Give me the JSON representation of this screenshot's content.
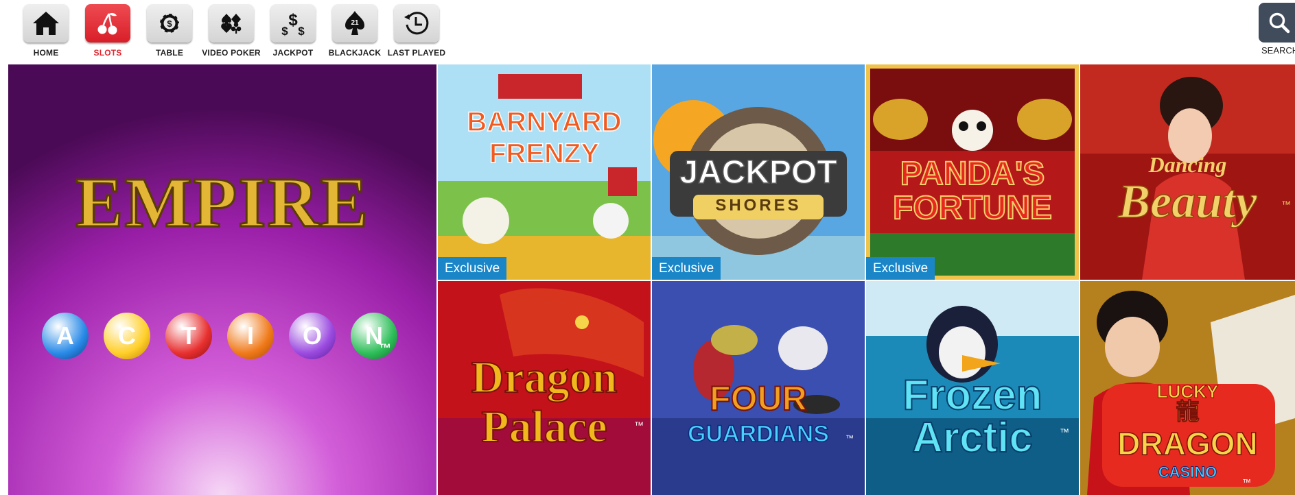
{
  "nav": {
    "items": [
      {
        "label": "HOME",
        "icon": "home-icon",
        "active": false
      },
      {
        "label": "SLOTS",
        "icon": "cherries-icon",
        "active": true
      },
      {
        "label": "TABLE",
        "icon": "casino-chip-icon",
        "active": false
      },
      {
        "label": "VIDEO POKER",
        "icon": "card-suits-icon",
        "active": false
      },
      {
        "label": "JACKPOT",
        "icon": "dollar-signs-icon",
        "active": false
      },
      {
        "label": "BLACKJACK",
        "icon": "spade-21-icon",
        "active": false
      },
      {
        "label": "LAST PLAYED",
        "icon": "history-clock-icon",
        "active": false
      }
    ],
    "search_label": "SEARCH"
  },
  "games": [
    {
      "name": "Empire Action",
      "title_line1": "EMPIRE",
      "title_line2": "ACTION",
      "title_letters": [
        "A",
        "C",
        "T",
        "I",
        "O",
        "N"
      ],
      "tm": "™"
    },
    {
      "name": "Barnyard Frenzy",
      "title_line1": "BARNYARD",
      "title_line2": "FRENZY",
      "badge": "Exclusive"
    },
    {
      "name": "Jackpot Shores",
      "title_line1": "JACKPOT",
      "title_line2": "SHORES",
      "badge": "Exclusive"
    },
    {
      "name": "Panda's Fortune",
      "title_line1": "PANDA'S",
      "title_line2": "FORTUNE",
      "badge": "Exclusive"
    },
    {
      "name": "Dancing Beauty",
      "title_line1": "Dancing",
      "title_line2": "Beauty",
      "tm": "™"
    },
    {
      "name": "Dragon Palace",
      "title_line1": "Dragon",
      "title_line2": "Palace",
      "tm": "™"
    },
    {
      "name": "Four Guardians",
      "title_line1": "FOUR",
      "title_line2": "GUARDIANS",
      "tm": "™"
    },
    {
      "name": "Frozen Arctic",
      "title_line1": "Frozen",
      "title_line2": "Arctic",
      "tm": "™"
    },
    {
      "name": "Lucky Dragon Casino",
      "title_line1": "LUCKY",
      "title_line2": "DRAGON",
      "title_line3": "CASINO",
      "glyph": "龍",
      "tm": "™"
    }
  ],
  "colors": {
    "active_accent": "#e2262f",
    "exclusive_badge": "#1a86c8",
    "search_button": "#404c5c"
  }
}
